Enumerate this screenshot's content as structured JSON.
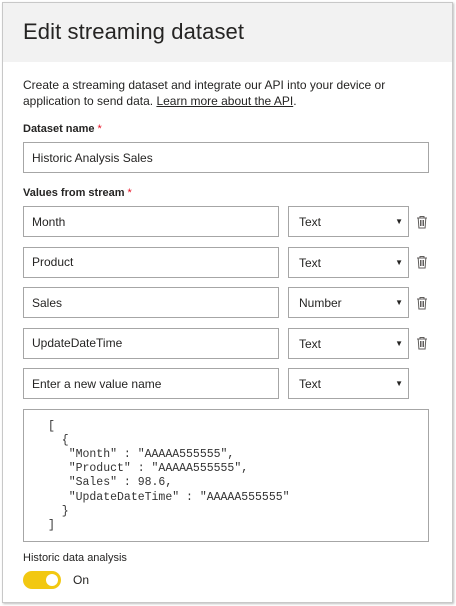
{
  "dialog": {
    "title": "Edit streaming dataset",
    "description": "Create a streaming dataset and integrate our API into your device or application to send data. ",
    "learn_more": "Learn more about the API",
    "learn_more_suffix": "."
  },
  "dataset_name": {
    "label": "Dataset name",
    "required_marker": "*",
    "value": "Historic Analysis Sales"
  },
  "values_from_stream": {
    "label": "Values from stream",
    "required_marker": "*",
    "rows": [
      {
        "name": "Month",
        "type": "Text"
      },
      {
        "name": "Product",
        "type": "Text"
      },
      {
        "name": "Sales",
        "type": "Number"
      },
      {
        "name": "UpdateDateTime",
        "type": "Text"
      }
    ],
    "new_row": {
      "placeholder": "Enter a new value name",
      "type": "Text"
    }
  },
  "json_preview": "[\n  {\n   \"Month\" : \"AAAAA555555\",\n   \"Product\" : \"AAAAA555555\",\n   \"Sales\" : 98.6,\n   \"UpdateDateTime\" : \"AAAAA555555\"\n  }\n]",
  "historic": {
    "label": "Historic data analysis",
    "state": "On",
    "enabled": true,
    "toggle_color": "#f2c811"
  },
  "icons": {
    "caret": "chevron-down-icon",
    "delete": "trash-icon"
  }
}
